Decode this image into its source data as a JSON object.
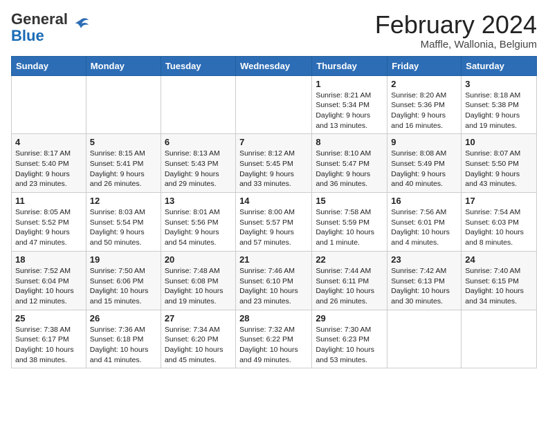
{
  "header": {
    "logo_general": "General",
    "logo_blue": "Blue",
    "month_year": "February 2024",
    "location": "Maffle, Wallonia, Belgium"
  },
  "calendar": {
    "days_of_week": [
      "Sunday",
      "Monday",
      "Tuesday",
      "Wednesday",
      "Thursday",
      "Friday",
      "Saturday"
    ],
    "weeks": [
      [
        {
          "day": "",
          "info": ""
        },
        {
          "day": "",
          "info": ""
        },
        {
          "day": "",
          "info": ""
        },
        {
          "day": "",
          "info": ""
        },
        {
          "day": "1",
          "info": "Sunrise: 8:21 AM\nSunset: 5:34 PM\nDaylight: 9 hours\nand 13 minutes."
        },
        {
          "day": "2",
          "info": "Sunrise: 8:20 AM\nSunset: 5:36 PM\nDaylight: 9 hours\nand 16 minutes."
        },
        {
          "day": "3",
          "info": "Sunrise: 8:18 AM\nSunset: 5:38 PM\nDaylight: 9 hours\nand 19 minutes."
        }
      ],
      [
        {
          "day": "4",
          "info": "Sunrise: 8:17 AM\nSunset: 5:40 PM\nDaylight: 9 hours\nand 23 minutes."
        },
        {
          "day": "5",
          "info": "Sunrise: 8:15 AM\nSunset: 5:41 PM\nDaylight: 9 hours\nand 26 minutes."
        },
        {
          "day": "6",
          "info": "Sunrise: 8:13 AM\nSunset: 5:43 PM\nDaylight: 9 hours\nand 29 minutes."
        },
        {
          "day": "7",
          "info": "Sunrise: 8:12 AM\nSunset: 5:45 PM\nDaylight: 9 hours\nand 33 minutes."
        },
        {
          "day": "8",
          "info": "Sunrise: 8:10 AM\nSunset: 5:47 PM\nDaylight: 9 hours\nand 36 minutes."
        },
        {
          "day": "9",
          "info": "Sunrise: 8:08 AM\nSunset: 5:49 PM\nDaylight: 9 hours\nand 40 minutes."
        },
        {
          "day": "10",
          "info": "Sunrise: 8:07 AM\nSunset: 5:50 PM\nDaylight: 9 hours\nand 43 minutes."
        }
      ],
      [
        {
          "day": "11",
          "info": "Sunrise: 8:05 AM\nSunset: 5:52 PM\nDaylight: 9 hours\nand 47 minutes."
        },
        {
          "day": "12",
          "info": "Sunrise: 8:03 AM\nSunset: 5:54 PM\nDaylight: 9 hours\nand 50 minutes."
        },
        {
          "day": "13",
          "info": "Sunrise: 8:01 AM\nSunset: 5:56 PM\nDaylight: 9 hours\nand 54 minutes."
        },
        {
          "day": "14",
          "info": "Sunrise: 8:00 AM\nSunset: 5:57 PM\nDaylight: 9 hours\nand 57 minutes."
        },
        {
          "day": "15",
          "info": "Sunrise: 7:58 AM\nSunset: 5:59 PM\nDaylight: 10 hours\nand 1 minute."
        },
        {
          "day": "16",
          "info": "Sunrise: 7:56 AM\nSunset: 6:01 PM\nDaylight: 10 hours\nand 4 minutes."
        },
        {
          "day": "17",
          "info": "Sunrise: 7:54 AM\nSunset: 6:03 PM\nDaylight: 10 hours\nand 8 minutes."
        }
      ],
      [
        {
          "day": "18",
          "info": "Sunrise: 7:52 AM\nSunset: 6:04 PM\nDaylight: 10 hours\nand 12 minutes."
        },
        {
          "day": "19",
          "info": "Sunrise: 7:50 AM\nSunset: 6:06 PM\nDaylight: 10 hours\nand 15 minutes."
        },
        {
          "day": "20",
          "info": "Sunrise: 7:48 AM\nSunset: 6:08 PM\nDaylight: 10 hours\nand 19 minutes."
        },
        {
          "day": "21",
          "info": "Sunrise: 7:46 AM\nSunset: 6:10 PM\nDaylight: 10 hours\nand 23 minutes."
        },
        {
          "day": "22",
          "info": "Sunrise: 7:44 AM\nSunset: 6:11 PM\nDaylight: 10 hours\nand 26 minutes."
        },
        {
          "day": "23",
          "info": "Sunrise: 7:42 AM\nSunset: 6:13 PM\nDaylight: 10 hours\nand 30 minutes."
        },
        {
          "day": "24",
          "info": "Sunrise: 7:40 AM\nSunset: 6:15 PM\nDaylight: 10 hours\nand 34 minutes."
        }
      ],
      [
        {
          "day": "25",
          "info": "Sunrise: 7:38 AM\nSunset: 6:17 PM\nDaylight: 10 hours\nand 38 minutes."
        },
        {
          "day": "26",
          "info": "Sunrise: 7:36 AM\nSunset: 6:18 PM\nDaylight: 10 hours\nand 41 minutes."
        },
        {
          "day": "27",
          "info": "Sunrise: 7:34 AM\nSunset: 6:20 PM\nDaylight: 10 hours\nand 45 minutes."
        },
        {
          "day": "28",
          "info": "Sunrise: 7:32 AM\nSunset: 6:22 PM\nDaylight: 10 hours\nand 49 minutes."
        },
        {
          "day": "29",
          "info": "Sunrise: 7:30 AM\nSunset: 6:23 PM\nDaylight: 10 hours\nand 53 minutes."
        },
        {
          "day": "",
          "info": ""
        },
        {
          "day": "",
          "info": ""
        }
      ]
    ]
  }
}
